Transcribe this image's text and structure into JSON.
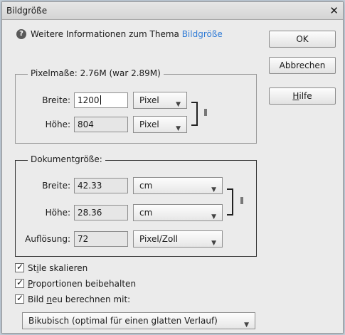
{
  "window": {
    "title": "Bildgröße",
    "close_glyph": "✕"
  },
  "info": {
    "icon": "?",
    "text": "Weitere Informationen zum Thema ",
    "link": "Bildgröße"
  },
  "buttons": {
    "ok": "OK",
    "cancel": "Abbrechen",
    "help_accel": "H",
    "help_rest": "ilfe"
  },
  "pixel_dimensions": {
    "legend": "Pixelmaße: 2.76M (war 2.89M)",
    "width": {
      "label": "Breite:",
      "value": "1200",
      "unit": "Pixel"
    },
    "height": {
      "label": "Höhe:",
      "value": "804",
      "unit": "Pixel"
    }
  },
  "document_size": {
    "legend": "Dokumentgröße:",
    "width": {
      "label": "Breite:",
      "value": "42.33",
      "unit": "cm"
    },
    "height": {
      "label": "Höhe:",
      "value": "28.36",
      "unit": "cm"
    },
    "resolution": {
      "label": "Auflösung:",
      "value": "72",
      "unit": "Pixel/Zoll"
    }
  },
  "options": {
    "scale_styles": {
      "pre": "St",
      "accel": "i",
      "post": "le skalieren",
      "checked": true
    },
    "constrain": {
      "pre": "",
      "accel": "P",
      "post": "roportionen beibehalten",
      "checked": true
    },
    "resample": {
      "pre": "Bild ",
      "accel": "n",
      "post": "eu berechnen mit:",
      "checked": true
    }
  },
  "resample_method": "Bikubisch (optimal für einen glatten Verlauf)",
  "glyphs": {
    "dropdown_arrow": "▼",
    "check": "✓"
  }
}
